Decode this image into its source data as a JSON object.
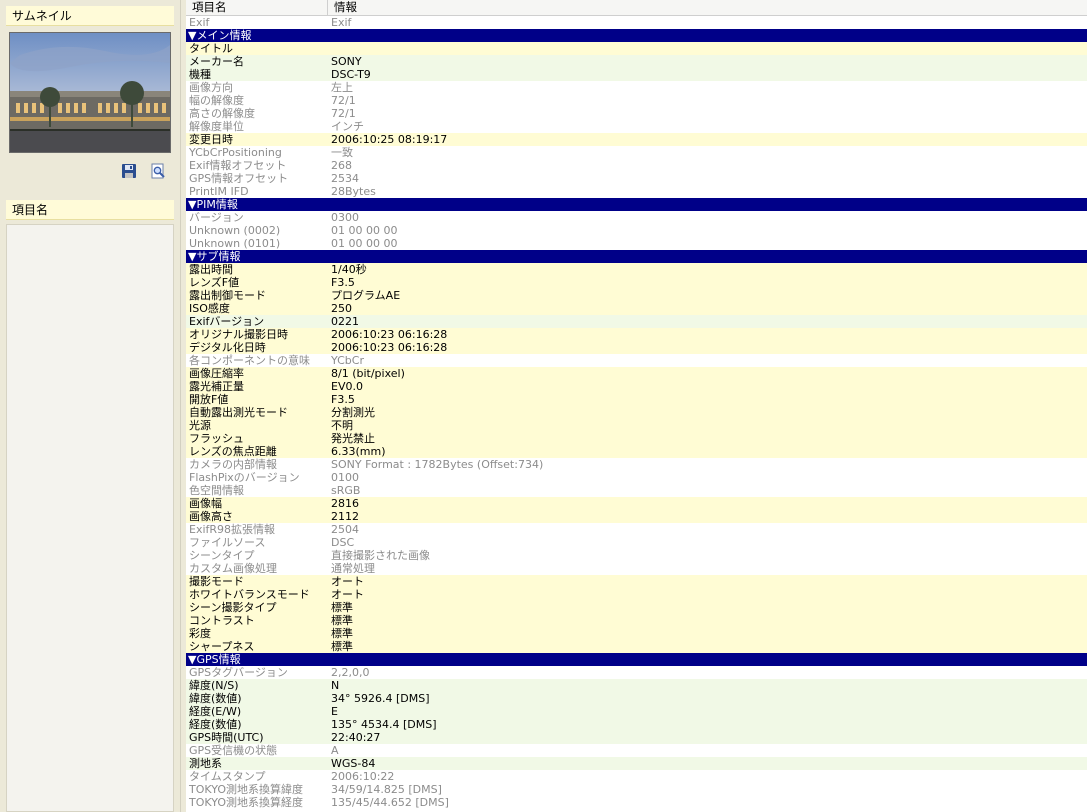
{
  "left": {
    "thumbnail_header": "サムネイル",
    "item_header": "項目名",
    "icons": [
      "save-icon",
      "zoom-icon"
    ]
  },
  "grid": {
    "col_item": "項目名",
    "col_info": "情報"
  },
  "rows": [
    {
      "t": "gray",
      "k": "Exif",
      "v": "Exif"
    },
    {
      "t": "section",
      "k": "▼メイン情報",
      "v": ""
    },
    {
      "t": "yellow",
      "k": "タイトル",
      "v": ""
    },
    {
      "t": "green",
      "k": "メーカー名",
      "v": "SONY"
    },
    {
      "t": "green",
      "k": "機種",
      "v": "DSC-T9"
    },
    {
      "t": "gray",
      "k": "画像方向",
      "v": "左上"
    },
    {
      "t": "gray",
      "k": "幅の解像度",
      "v": "72/1"
    },
    {
      "t": "gray",
      "k": "高さの解像度",
      "v": "72/1"
    },
    {
      "t": "gray",
      "k": "解像度単位",
      "v": "インチ"
    },
    {
      "t": "yellow",
      "k": "変更日時",
      "v": "2006:10:25 08:19:17"
    },
    {
      "t": "gray",
      "k": "YCbCrPositioning",
      "v": "一致"
    },
    {
      "t": "gray",
      "k": "Exif情報オフセット",
      "v": "268"
    },
    {
      "t": "gray",
      "k": "GPS情報オフセット",
      "v": "2534"
    },
    {
      "t": "gray",
      "k": "PrintIM IFD",
      "v": "28Bytes"
    },
    {
      "t": "section",
      "k": "▼PIM情報",
      "v": ""
    },
    {
      "t": "gray",
      "k": "バージョン",
      "v": "0300"
    },
    {
      "t": "gray",
      "k": "Unknown (0002)",
      "v": "01 00 00 00"
    },
    {
      "t": "gray",
      "k": "Unknown (0101)",
      "v": "01 00 00 00"
    },
    {
      "t": "section",
      "k": "▼サブ情報",
      "v": ""
    },
    {
      "t": "yellow",
      "k": "露出時間",
      "v": "1/40秒"
    },
    {
      "t": "yellow",
      "k": "レンズF値",
      "v": "F3.5"
    },
    {
      "t": "yellow",
      "k": "露出制御モード",
      "v": "プログラムAE"
    },
    {
      "t": "yellow",
      "k": "ISO感度",
      "v": "250"
    },
    {
      "t": "green",
      "k": "Exifバージョン",
      "v": "0221"
    },
    {
      "t": "yellow",
      "k": "オリジナル撮影日時",
      "v": "2006:10:23 06:16:28"
    },
    {
      "t": "yellow",
      "k": "デジタル化日時",
      "v": "2006:10:23 06:16:28"
    },
    {
      "t": "gray",
      "k": "各コンポーネントの意味",
      "v": "YCbCr"
    },
    {
      "t": "yellow",
      "k": "画像圧縮率",
      "v": "8/1 (bit/pixel)"
    },
    {
      "t": "yellow",
      "k": "露光補正量",
      "v": "EV0.0"
    },
    {
      "t": "yellow",
      "k": "開放F値",
      "v": "F3.5"
    },
    {
      "t": "yellow",
      "k": "自動露出測光モード",
      "v": "分割測光"
    },
    {
      "t": "yellow",
      "k": "光源",
      "v": "不明"
    },
    {
      "t": "yellow",
      "k": "フラッシュ",
      "v": "発光禁止"
    },
    {
      "t": "yellow",
      "k": "レンズの焦点距離",
      "v": "6.33(mm)"
    },
    {
      "t": "gray",
      "k": "カメラの内部情報",
      "v": "SONY Format : 1782Bytes (Offset:734)"
    },
    {
      "t": "gray",
      "k": "FlashPixのバージョン",
      "v": "0100"
    },
    {
      "t": "gray",
      "k": "色空間情報",
      "v": "sRGB"
    },
    {
      "t": "yellow",
      "k": "画像幅",
      "v": "2816"
    },
    {
      "t": "yellow",
      "k": "画像高さ",
      "v": "2112"
    },
    {
      "t": "gray",
      "k": "ExifR98拡張情報",
      "v": "2504"
    },
    {
      "t": "gray",
      "k": "ファイルソース",
      "v": "DSC"
    },
    {
      "t": "gray",
      "k": "シーンタイプ",
      "v": "直接撮影された画像"
    },
    {
      "t": "gray",
      "k": "カスタム画像処理",
      "v": "通常処理"
    },
    {
      "t": "yellow",
      "k": "撮影モード",
      "v": "オート"
    },
    {
      "t": "yellow",
      "k": "ホワイトバランスモード",
      "v": "オート"
    },
    {
      "t": "yellow",
      "k": "シーン撮影タイプ",
      "v": "標準"
    },
    {
      "t": "yellow",
      "k": "コントラスト",
      "v": "標準"
    },
    {
      "t": "yellow",
      "k": "彩度",
      "v": "標準"
    },
    {
      "t": "yellow",
      "k": "シャープネス",
      "v": "標準"
    },
    {
      "t": "section",
      "k": "▼GPS情報",
      "v": ""
    },
    {
      "t": "gray",
      "k": "GPSタグバージョン",
      "v": "2,2,0,0"
    },
    {
      "t": "green",
      "k": "緯度(N/S)",
      "v": "N"
    },
    {
      "t": "green",
      "k": "緯度(数値)",
      "v": "34° 5926.4 [DMS]"
    },
    {
      "t": "green",
      "k": "経度(E/W)",
      "v": "E"
    },
    {
      "t": "green",
      "k": "経度(数値)",
      "v": "135° 4534.4 [DMS]"
    },
    {
      "t": "green",
      "k": "GPS時間(UTC)",
      "v": "22:40:27"
    },
    {
      "t": "gray",
      "k": "GPS受信機の状態",
      "v": "A"
    },
    {
      "t": "green",
      "k": "測地系",
      "v": "WGS-84"
    },
    {
      "t": "gray",
      "k": "タイムスタンプ",
      "v": "2006:10:22"
    },
    {
      "t": "gray",
      "k": "TOKYO測地系換算緯度",
      "v": "34/59/14.825 [DMS]"
    },
    {
      "t": "gray",
      "k": "TOKYO測地系換算経度",
      "v": "135/45/44.652 [DMS]"
    }
  ]
}
